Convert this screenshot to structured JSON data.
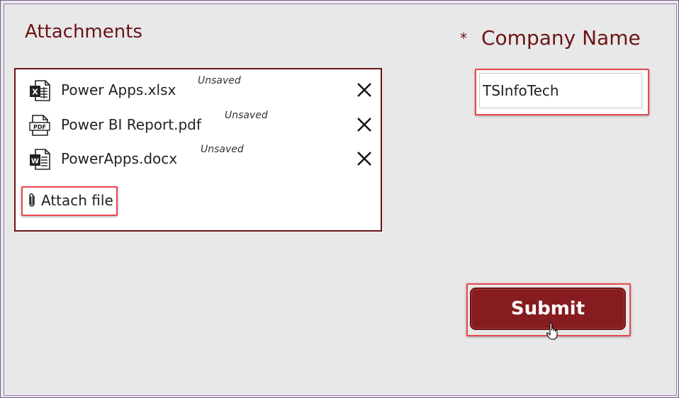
{
  "attachments": {
    "title": "Attachments",
    "files": [
      {
        "name": "Power Apps.xlsx",
        "status": "Unsaved",
        "icon": "excel-file-icon",
        "badge": "X"
      },
      {
        "name": "Power BI Report.pdf",
        "status": "Unsaved",
        "icon": "pdf-file-icon",
        "badge": "PDF"
      },
      {
        "name": "PowerApps.docx",
        "status": "Unsaved",
        "icon": "word-file-icon",
        "badge": "W"
      }
    ],
    "attach_label": "Attach file"
  },
  "company": {
    "required_marker": "*",
    "label": "Company Name",
    "value": "TSInfoTech"
  },
  "submit": {
    "label": "Submit"
  },
  "colors": {
    "accent": "#6b1416",
    "button": "#861c20",
    "highlight": "#e8474c",
    "background": "#e8e8e8"
  }
}
